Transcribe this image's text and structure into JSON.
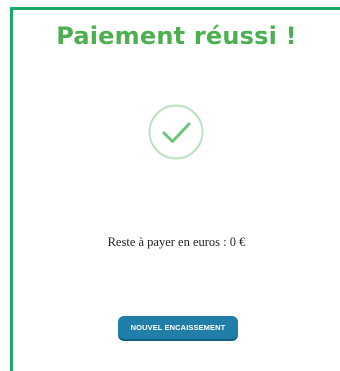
{
  "success_panel": {
    "title": "Paiement réussi !",
    "message": "Reste à payer en euros : 0 €",
    "new_payment_button": "NOUVEL ENCAISSEMENT"
  },
  "icons": {
    "status_icon": "check-circle-icon"
  },
  "colors": {
    "accent_green": "#1aa967",
    "title_green": "#4caf50",
    "check_stroke": "#6cc47d",
    "check_ring": "#b9e2bf",
    "button_blue": "#1f7fa8"
  }
}
